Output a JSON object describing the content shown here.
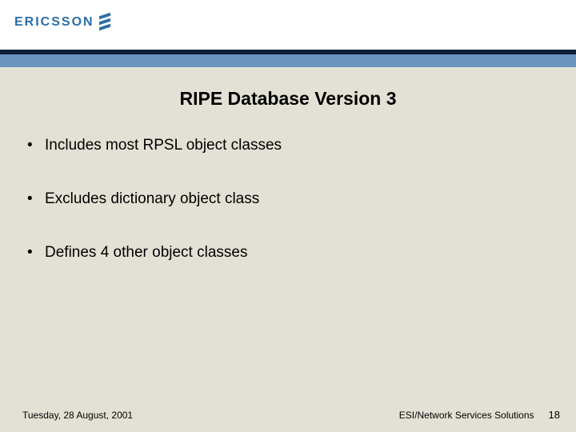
{
  "brand": {
    "name": "ERICSSON"
  },
  "slide": {
    "title": "RIPE Database Version 3",
    "bullets": [
      "Includes most RPSL object classes",
      "Excludes dictionary object class",
      "Defines 4 other object classes"
    ]
  },
  "footer": {
    "date": "Tuesday, 28 August, 2001",
    "org": "ESI/Network Services Solutions",
    "page": "18"
  }
}
